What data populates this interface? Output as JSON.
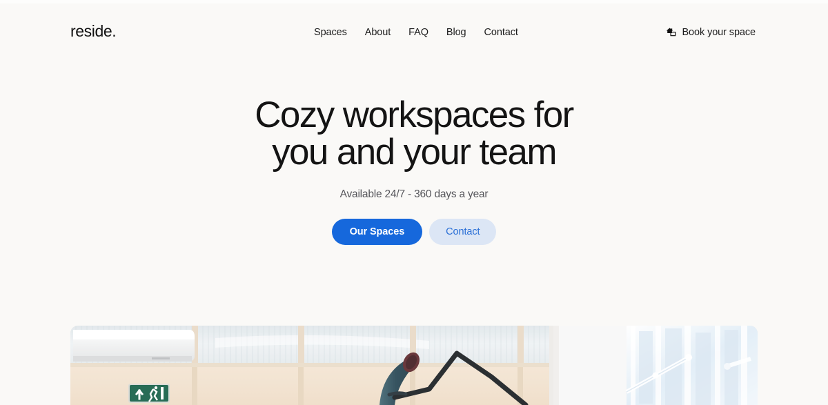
{
  "brand": {
    "logo_text": "reside."
  },
  "nav": {
    "items": [
      {
        "label": "Spaces"
      },
      {
        "label": "About"
      },
      {
        "label": "FAQ"
      },
      {
        "label": "Blog"
      },
      {
        "label": "Contact"
      }
    ]
  },
  "header_cta": {
    "icon": "home-arrow-icon",
    "label": "Book your space"
  },
  "hero": {
    "headline_line1": "Cozy workspaces for",
    "headline_line2": "you and your team",
    "subheadline": "Available 24/7 - 360 days a year",
    "primary_button": "Our Spaces",
    "secondary_button": "Contact"
  },
  "hero_image": {
    "alt": "Office interior with frosted glass partitions, wall air conditioner, green emergency exit sign, dark teal desk lamp and bright windows"
  },
  "colors": {
    "page_background": "#faf9f7",
    "text_primary": "#141414",
    "text_muted": "#55555a",
    "accent_blue": "#1668dc",
    "accent_blue_soft": "#dce6f5",
    "exit_sign_green": "#0f5c43"
  }
}
